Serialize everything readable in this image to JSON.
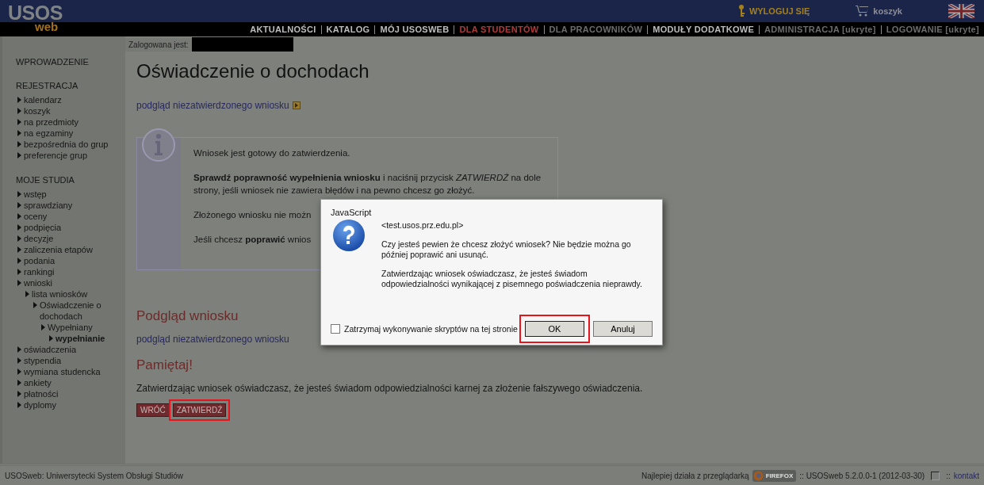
{
  "header": {
    "logo_main": "USOS",
    "logo_sub": "web",
    "logout": "WYLOGUJ SIĘ",
    "cart": "koszyk"
  },
  "nav": [
    {
      "label": "AKTUALNOŚCI",
      "selected": false,
      "disabled": false
    },
    {
      "label": "KATALOG",
      "selected": false,
      "disabled": false
    },
    {
      "label": "MÓJ USOSWEB",
      "selected": false,
      "disabled": false
    },
    {
      "label": "DLA STUDENTÓW",
      "selected": true,
      "disabled": false
    },
    {
      "label": "DLA PRACOWNIKÓW",
      "selected": false,
      "disabled": true
    },
    {
      "label": "MODUŁY DODATKOWE",
      "selected": false,
      "disabled": false
    },
    {
      "label": "ADMINISTRACJA [ukryte]",
      "selected": false,
      "disabled": true
    },
    {
      "label": "LOGOWANIE [ukryte]",
      "selected": false,
      "disabled": true
    }
  ],
  "login": {
    "label": "Zalogowana jest:"
  },
  "sidebar": [
    {
      "title": "WPROWADZENIE"
    },
    {
      "title": "REJESTRACJA",
      "items": [
        {
          "label": "kalendarz",
          "selected": false
        },
        {
          "label": "koszyk",
          "selected": false
        },
        {
          "label": "na przedmioty",
          "selected": false
        },
        {
          "label": "na egzaminy",
          "selected": false
        },
        {
          "label": "bezpośrednia do grup",
          "selected": false
        },
        {
          "label": "preferencje grup",
          "selected": false
        }
      ]
    },
    {
      "title": "MOJE STUDIA",
      "items": [
        {
          "label": "wstęp",
          "selected": false
        },
        {
          "label": "sprawdziany",
          "selected": false
        },
        {
          "label": "oceny",
          "selected": false
        },
        {
          "label": "podpięcia",
          "selected": false
        },
        {
          "label": "decyzje",
          "selected": false
        },
        {
          "label": "zaliczenia etapów",
          "selected": false
        },
        {
          "label": "podania",
          "selected": false
        },
        {
          "label": "rankingi",
          "selected": false
        },
        {
          "label": "wnioski",
          "selected": false,
          "children": [
            {
              "label": "lista wniosków",
              "selected": false,
              "children": [
                {
                  "label": "Oświadczenie o dochodach",
                  "selected": false,
                  "children": [
                    {
                      "label": "Wypełniany",
                      "selected": false,
                      "children": [
                        {
                          "label": "wypełnianie",
                          "selected": true
                        }
                      ]
                    }
                  ]
                }
              ]
            }
          ]
        },
        {
          "label": "oświadczenia",
          "selected": false
        },
        {
          "label": "stypendia",
          "selected": false
        },
        {
          "label": "wymiana studencka",
          "selected": false
        },
        {
          "label": "ankiety",
          "selected": false
        },
        {
          "label": "płatności",
          "selected": false
        },
        {
          "label": "dyplomy",
          "selected": false
        }
      ]
    }
  ],
  "main": {
    "title": "Oświadczenie o dochodach",
    "preview_link": "podgląd niezatwierdzonego wniosku",
    "info": [
      "Wniosek jest gotowy do zatwierdzenia.",
      "**Sprawdź poprawność wypełnienia wniosku** i naciśnij przycisk *ZATWIERDŹ* na dole strony, jeśli wniosek nie zawiera błędów i na pewno chcesz go złożyć.",
      "Złożonego wniosku nie możn",
      "Jeśli chcesz **poprawić** wnios"
    ],
    "preview_heading": "Podgląd wniosku",
    "preview_link_2": "podgląd niezatwierdzonego wniosku",
    "remember_heading": "Pamiętaj!",
    "remember_text": "Zatwierdzając wniosek oświadczasz, że jesteś świadom odpowiedzialności karnej za złożenie fałszywego oświadczenia.",
    "buttons": [
      {
        "label": "WRÓĆ",
        "highlighted": false
      },
      {
        "label": "ZATWIERDŹ",
        "highlighted": true
      }
    ]
  },
  "footer": {
    "left": "USOSweb: Uniwersytecki System Obsługi Studiów",
    "browser_note": "Najlepiej działa z przeglądarką",
    "browser_badge": "FIREFOX",
    "version": ":: USOSweb 5.2.0.0-1 (2012-03-30)",
    "contact_sep": "::",
    "contact": "kontakt"
  },
  "dialog": {
    "title": "JavaScript",
    "origin": "<test.usos.prz.edu.pl>",
    "messages": [
      "Czy jesteś pewien że chcesz złożyć wniosek? Nie będzie można go później poprawić ani usunąć.",
      "Zatwierdzając wniosek oświadczasz, że jesteś świadom odpowiedzialności wynikającej z pisemnego poświadczenia nieprawdy."
    ],
    "checkbox": {
      "label": "Zatrzymaj wykonywanie skryptów na tej stronie",
      "checked": false
    },
    "buttons": [
      {
        "label": "OK",
        "highlighted": true
      },
      {
        "label": "Anuluj",
        "highlighted": false
      }
    ]
  }
}
